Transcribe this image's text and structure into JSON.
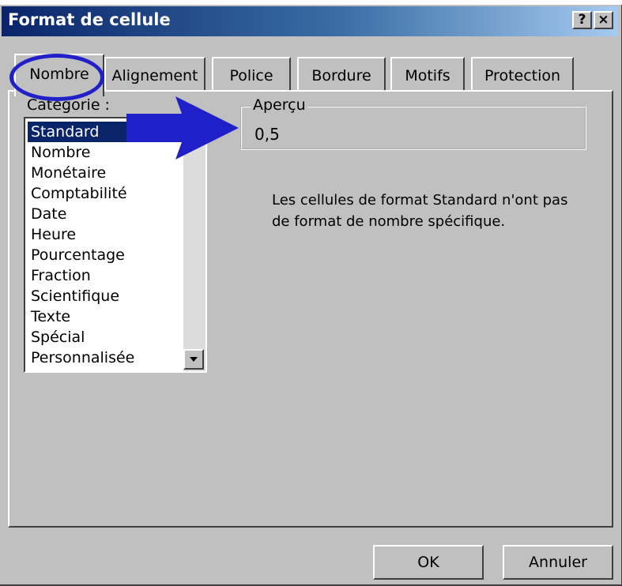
{
  "window": {
    "title": "Format de cellule",
    "help_glyph": "?",
    "close_glyph": "×"
  },
  "tabs": [
    {
      "label": "Nombre",
      "active": true
    },
    {
      "label": "Alignement",
      "active": false
    },
    {
      "label": "Police",
      "active": false
    },
    {
      "label": "Bordure",
      "active": false
    },
    {
      "label": "Motifs",
      "active": false
    },
    {
      "label": "Protection",
      "active": false
    }
  ],
  "category": {
    "label": "Catégorie :",
    "items": [
      "Standard",
      "Nombre",
      "Monétaire",
      "Comptabilité",
      "Date",
      "Heure",
      "Pourcentage",
      "Fraction",
      "Scientifique",
      "Texte",
      "Spécial",
      "Personnalisée"
    ],
    "selected": "Standard"
  },
  "preview": {
    "label": "Aperçu",
    "value": "0,5"
  },
  "description": "Les cellules de format Standard n'ont pas de format de nombre spécifique.",
  "buttons": {
    "ok": "OK",
    "cancel": "Annuler"
  },
  "colors": {
    "title_bar": "#0a246a",
    "dialog_bg": "#c0c0c0",
    "selection": "#0a246a",
    "annotation": "#2020c8"
  },
  "annotations": {
    "ellipse_target": "tab-nombre",
    "arrow_target": "preview-box"
  }
}
